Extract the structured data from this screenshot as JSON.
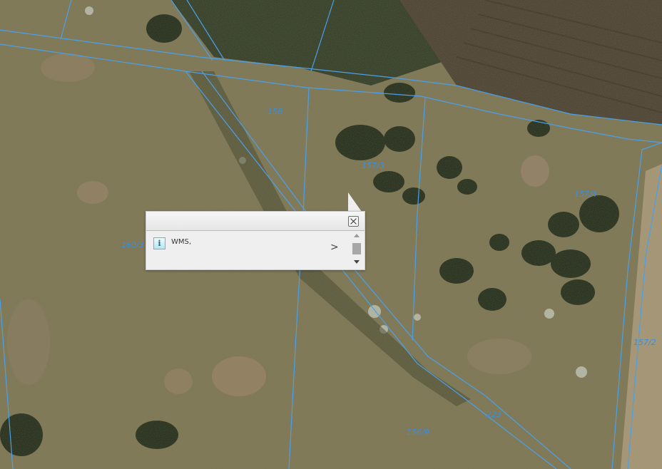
{
  "map": {
    "layer": "WMS",
    "parcel_labels": {
      "p158": "158",
      "p157_3": "157/3",
      "p157_4": "157/4",
      "p160_3": "160/3",
      "p157_2": "157/2",
      "p223": "223",
      "p156_9": "156/9"
    }
  },
  "popup": {
    "result_text": "WMS,",
    "info_icon_char": "i",
    "close_icon": "close-icon",
    "next_icon": "chevron-right-icon",
    "next_char": ">"
  },
  "colors": {
    "boundary": "#4aa0ec",
    "label": "#3a8fe0",
    "popup_bg": "#efefef"
  }
}
